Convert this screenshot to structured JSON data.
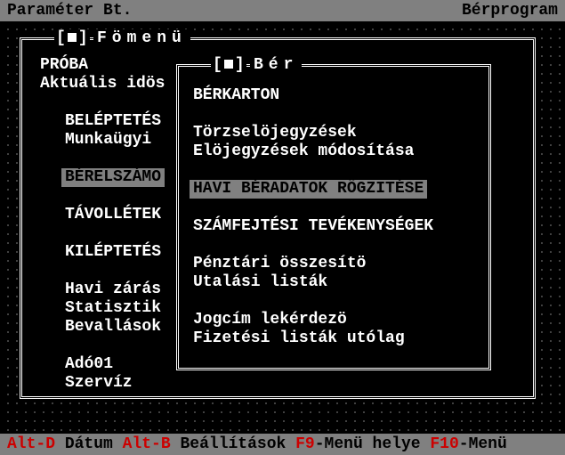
{
  "topbar": {
    "left": "Paraméter Bt.",
    "right": "Bérprogram"
  },
  "main_window": {
    "title": "Fömenü",
    "line1": "PRÓBA",
    "line2": "Aktuális idös",
    "items": [
      "BELÉPTETÉS",
      "Munkaügyi",
      "BÉRELSZÁMO",
      "TÁVOLLÉTEK",
      "KILÉPTETÉS",
      "Havi zárás",
      "Statisztik",
      "Bevallások",
      "Adó01",
      "Szervíz"
    ]
  },
  "sub_window": {
    "title": "Bér",
    "items": [
      "BÉRKARTON",
      "Törzselöjegyzések",
      "Elöjegyzések módosítása",
      "HAVI BÉRADATOK RÖGZITÉSE",
      "SZÁMFEJTÉSI TEVÉKENYSÉGEK",
      "Pénztári összesítö",
      "Utalási listák",
      "Jogcím lekérdezö",
      "Fizetési listák utólag"
    ]
  },
  "statusbar": {
    "k1": "Alt-D",
    "v1": "Dátum",
    "k2": "Alt-B",
    "v2": "Beállítások",
    "k3": "F9",
    "v3": "-Menü helye",
    "k4": "F10",
    "v4": "-Menü"
  }
}
